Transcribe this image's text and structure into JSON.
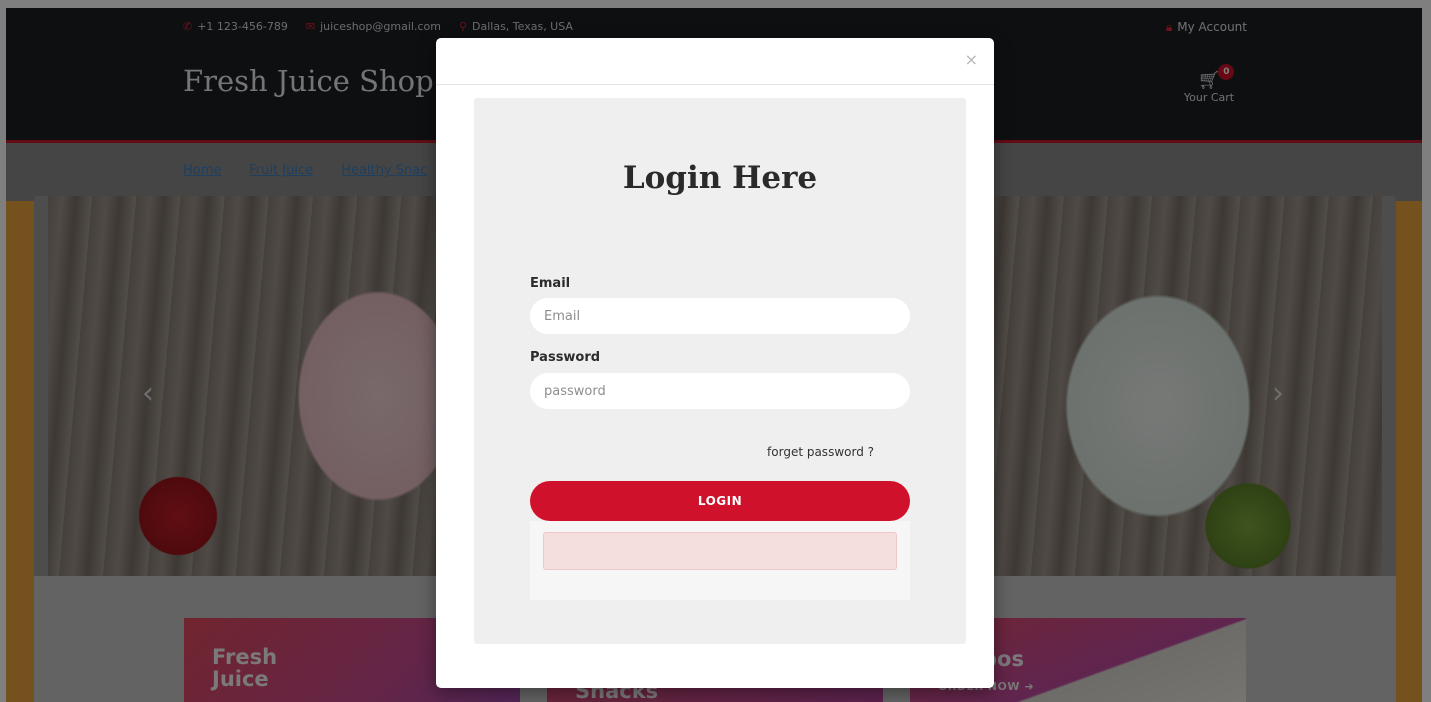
{
  "header": {
    "phone": "+1 123-456-789",
    "email": "juiceshop@gmail.com",
    "location": "Dallas, Texas, USA",
    "account_label": "My Account",
    "brand": "Fresh Juice Shop",
    "cart_label": "Your Cart",
    "cart_count": "0"
  },
  "nav": {
    "items": [
      "Home",
      "Fruit Juice",
      "Healthy Snac"
    ]
  },
  "slider": {
    "prev_glyph": "‹",
    "next_glyph": "›"
  },
  "promos": [
    {
      "title": "Fresh\nJuice"
    },
    {
      "title": "Snacks"
    },
    {
      "title": "bos",
      "cta": "ORDER NOW"
    }
  ],
  "modal": {
    "close_glyph": "×",
    "title": "Login Here",
    "email_label": "Email",
    "email_placeholder": "Email",
    "password_label": "Password",
    "password_placeholder": "password",
    "forget_label": "forget password ?",
    "login_label": "LOGIN"
  },
  "colors": {
    "accent": "#d0112b",
    "header_bg": "#1d1f22",
    "panel_bg": "#efefef",
    "error_bg": "#f5dede"
  }
}
